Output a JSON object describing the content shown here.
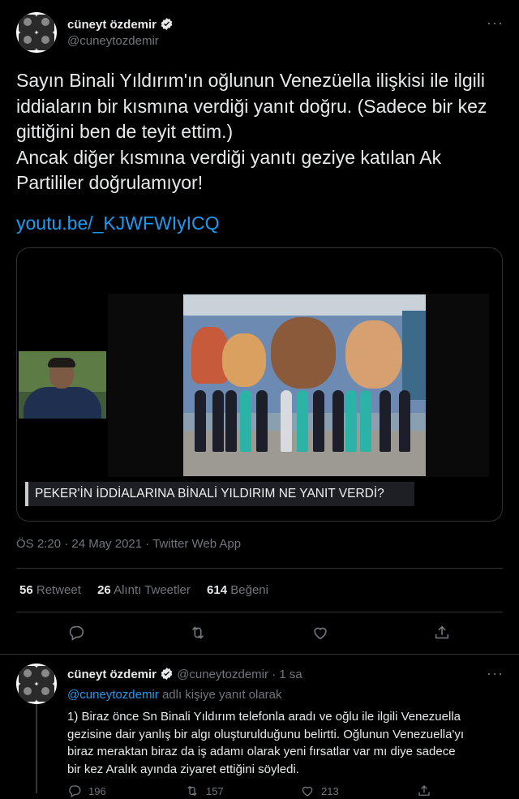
{
  "tweet": {
    "author_name": "cüneyt özdemir",
    "author_handle": "@cuneytozdemir",
    "more_icon": "more-horizontal-icon",
    "text_lines": [
      "Sayın Binali Yıldırım'ın oğlunun Venezüella ilişkisi ile ilgili",
      "iddiaların bir kısmına verdiği yanıt doğru. (Sadece bir kez",
      "gittiğini ben de teyit ettim.)",
      "Ancak diğer kısmına verdiği yanıtı geziye katılan Ak",
      "Partililer doğrulamıyor!"
    ],
    "link": "youtu.be/_KJWFWIyICQ",
    "card_caption": "PEKER'İN İDDİALARINA BİNALİ YILDIRIM NE YANIT VERDİ?",
    "meta": "ÖS 2:20 · 24 May 2021 · Twitter Web App",
    "stats": {
      "retweets_count": "56",
      "retweets_label": "Retweet",
      "quotes_count": "26",
      "quotes_label": "Alıntı Tweetler",
      "likes_count": "614",
      "likes_label": "Beğeni"
    }
  },
  "reply": {
    "author_name": "cüneyt özdemir",
    "author_handle": "@cuneytozdemir",
    "time": "· 1 sa",
    "replying_to_handle": "@cuneytozdemir",
    "replying_to_suffix": "adlı kişiye yanıt olarak",
    "text_lines": [
      "1) Biraz önce Sn Binali Yıldırım telefonla aradı ve oğlu ile ilgili Venezuella",
      "gezisine dair yanlış bir algı oluşturulduğunu belirtti. Oğlunun Venezuella'yı",
      "biraz meraktan biraz da iş adamı olarak yeni fırsatlar var mı diye sadece",
      "bir kez Aralık ayında ziyaret ettiğini söyledi."
    ],
    "reply_count": "196",
    "retweet_count": "157",
    "like_count": "213"
  },
  "colors": {
    "background": "#000000",
    "text": "#e7e9ea",
    "secondary": "#71767b",
    "link": "#1d9bf0",
    "divider": "#2f3336"
  }
}
